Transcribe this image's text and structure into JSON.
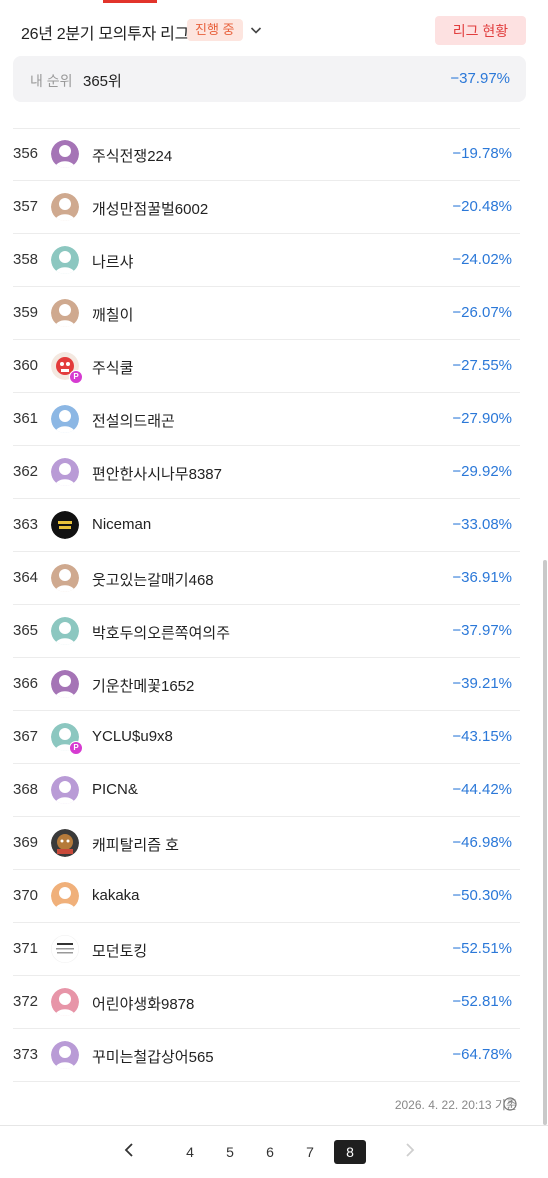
{
  "header": {
    "league_title": "26년 2분기 모의투자 리그",
    "status_badge": "진행 중",
    "league_status_button": "리그 현황"
  },
  "my_rank": {
    "label": "내 순위",
    "value": "365위",
    "return": "−37.97%"
  },
  "rows": [
    {
      "rank": "356",
      "name": "주식전쟁224",
      "ret": "−19.78%",
      "avatar": "default-purple"
    },
    {
      "rank": "357",
      "name": "개성만점꿀벌6002",
      "ret": "−20.48%",
      "avatar": "default-tan"
    },
    {
      "rank": "358",
      "name": "나르샤",
      "ret": "−24.02%",
      "avatar": "default-teal"
    },
    {
      "rank": "359",
      "name": "깨칠이",
      "ret": "−26.07%",
      "avatar": "default-tan"
    },
    {
      "rank": "360",
      "name": "주식쿨",
      "ret": "−27.55%",
      "avatar": "character-photo",
      "badge": "P"
    },
    {
      "rank": "361",
      "name": "전설의드래곤",
      "ret": "−27.90%",
      "avatar": "default-blue"
    },
    {
      "rank": "362",
      "name": "편안한사시나무8387",
      "ret": "−29.92%",
      "avatar": "default-lavender"
    },
    {
      "rank": "363",
      "name": "Niceman",
      "ret": "−33.08%",
      "avatar": "starwars-logo"
    },
    {
      "rank": "364",
      "name": "웃고있는갈매기468",
      "ret": "−36.91%",
      "avatar": "default-tan"
    },
    {
      "rank": "365",
      "name": "박호두의오른쪽여의주",
      "ret": "−37.97%",
      "avatar": "default-teal"
    },
    {
      "rank": "366",
      "name": "기운찬메꽃1652",
      "ret": "−39.21%",
      "avatar": "default-purple"
    },
    {
      "rank": "367",
      "name": "YCLU$u9x8",
      "ret": "−43.15%",
      "avatar": "default-teal-ring",
      "badge": "P"
    },
    {
      "rank": "368",
      "name": "PICN&",
      "ret": "−44.42%",
      "avatar": "default-lavender"
    },
    {
      "rank": "369",
      "name": "캐피탈리즘 호",
      "ret": "−46.98%",
      "avatar": "monkey-photo"
    },
    {
      "rank": "370",
      "name": "kakaka",
      "ret": "−50.30%",
      "avatar": "default-orange"
    },
    {
      "rank": "371",
      "name": "모던토킹",
      "ret": "−52.51%",
      "avatar": "text-image"
    },
    {
      "rank": "372",
      "name": "어린야생화9878",
      "ret": "−52.81%",
      "avatar": "default-pink"
    },
    {
      "rank": "373",
      "name": "꾸미는철갑상어565",
      "ret": "−64.78%",
      "avatar": "default-lavender"
    }
  ],
  "footer_note": "2026. 4. 22. 20:13 기준",
  "pagination": {
    "pages": [
      "4",
      "5",
      "6",
      "7",
      "8"
    ],
    "active": "8"
  },
  "colors": {
    "accent_red": "#e2342b",
    "negative_blue": "#2b78d8",
    "badge_bg": "#fde5df",
    "badge_text": "#e8623d",
    "premium_badge": "#d63bd1"
  },
  "icons": {
    "dropdown": "chevron-down-icon",
    "help": "question-circle-icon",
    "prev": "chevron-left-icon",
    "next": "chevron-right-icon"
  }
}
